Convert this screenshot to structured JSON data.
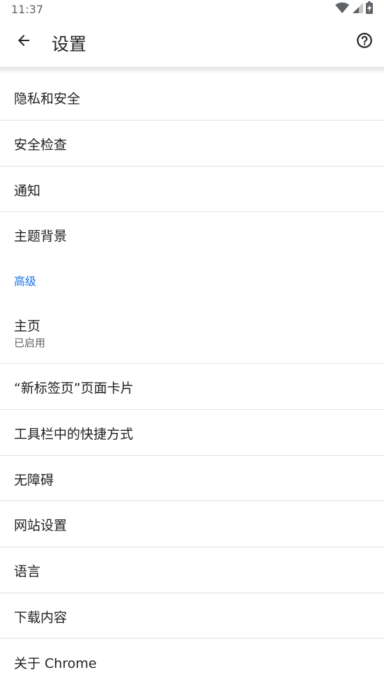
{
  "status_bar": {
    "time": "11:37"
  },
  "app_bar": {
    "title": "设置",
    "back_icon": "arrow-back-icon",
    "help_icon": "help-outline-icon"
  },
  "settings": {
    "privacy": "隐私和安全",
    "safety_check": "安全检查",
    "notifications": "通知",
    "themes": "主题背景",
    "advanced_header": "高级",
    "homepage": "主页",
    "homepage_summary": "已启用",
    "ntp_cards": "“新标签页”页面卡片",
    "toolbar_shortcut": "工具栏中的快捷方式",
    "accessibility": "无障碍",
    "site_settings": "网站设置",
    "languages": "语言",
    "downloads": "下载内容",
    "about": "关于 Chrome"
  },
  "colors": {
    "accent": "#1a73e8",
    "text_primary": "#202124",
    "text_secondary": "#5f6368",
    "divider": "#e0e0e0"
  }
}
